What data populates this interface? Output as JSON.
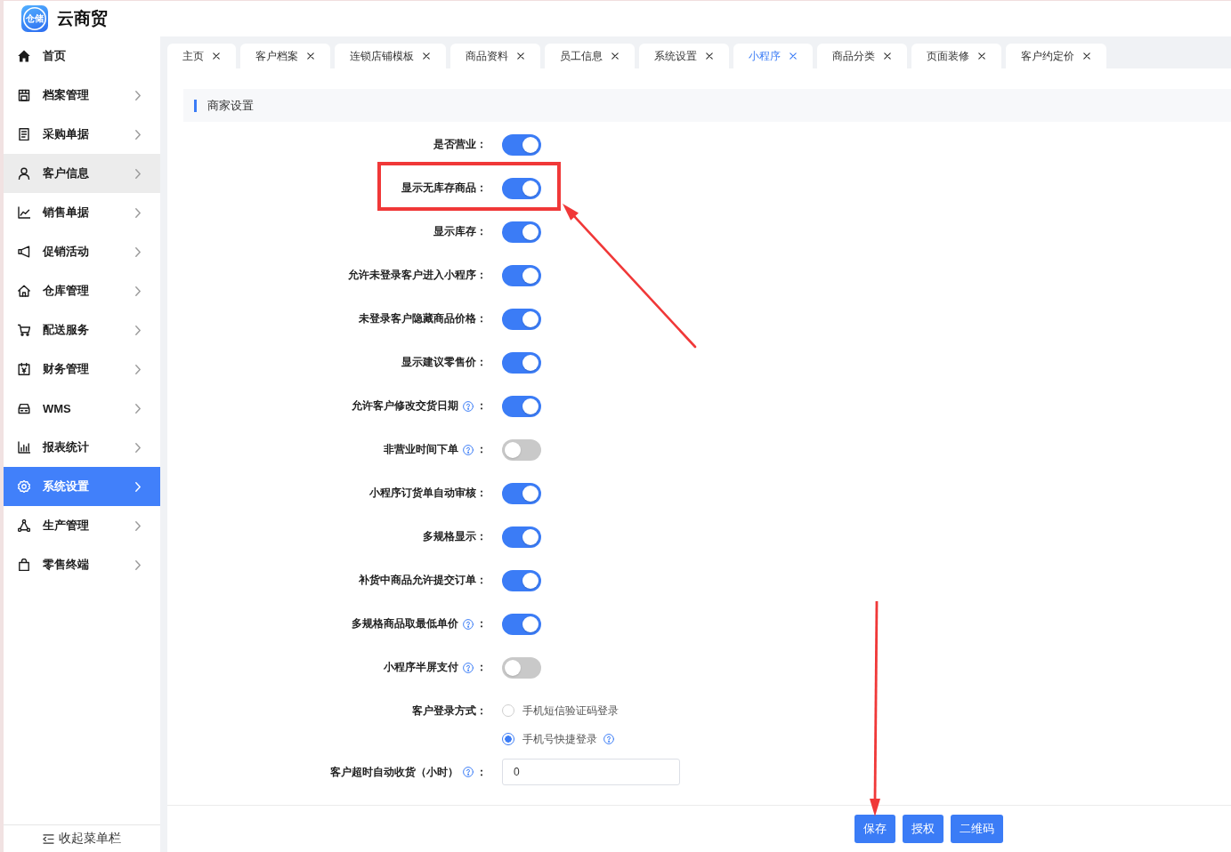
{
  "header": {
    "logo_text": "仓储",
    "title": "云商贸"
  },
  "sidebar": {
    "items": [
      {
        "label": "首页",
        "expandable": false,
        "selected": false,
        "hovered": false
      },
      {
        "label": "档案管理",
        "expandable": true,
        "selected": false,
        "hovered": false
      },
      {
        "label": "采购单据",
        "expandable": true,
        "selected": false,
        "hovered": false
      },
      {
        "label": "客户信息",
        "expandable": true,
        "selected": false,
        "hovered": true
      },
      {
        "label": "销售单据",
        "expandable": true,
        "selected": false,
        "hovered": false
      },
      {
        "label": "促销活动",
        "expandable": true,
        "selected": false,
        "hovered": false
      },
      {
        "label": "仓库管理",
        "expandable": true,
        "selected": false,
        "hovered": false
      },
      {
        "label": "配送服务",
        "expandable": true,
        "selected": false,
        "hovered": false
      },
      {
        "label": "财务管理",
        "expandable": true,
        "selected": false,
        "hovered": false
      },
      {
        "label": "WMS",
        "expandable": true,
        "selected": false,
        "hovered": false
      },
      {
        "label": "报表统计",
        "expandable": true,
        "selected": false,
        "hovered": false
      },
      {
        "label": "系统设置",
        "expandable": true,
        "selected": true,
        "hovered": false
      },
      {
        "label": "生产管理",
        "expandable": true,
        "selected": false,
        "hovered": false
      },
      {
        "label": "零售终端",
        "expandable": true,
        "selected": false,
        "hovered": false
      }
    ],
    "collapse_label": "收起菜单栏"
  },
  "tabs": [
    {
      "label": "主页",
      "selected": false
    },
    {
      "label": "客户档案",
      "selected": false
    },
    {
      "label": "连锁店铺模板",
      "selected": false
    },
    {
      "label": "商品资料",
      "selected": false
    },
    {
      "label": "员工信息",
      "selected": false
    },
    {
      "label": "系统设置",
      "selected": false
    },
    {
      "label": "小程序",
      "selected": true
    },
    {
      "label": "商品分类",
      "selected": false
    },
    {
      "label": "页面装修",
      "selected": false
    },
    {
      "label": "客户约定价",
      "selected": false
    }
  ],
  "section_title": "商家设置",
  "settings": [
    {
      "kind": "switch",
      "label": "是否营业：",
      "help": false,
      "on": true,
      "annotated": false
    },
    {
      "kind": "switch",
      "label": "显示无库存商品：",
      "help": false,
      "on": true,
      "annotated": true
    },
    {
      "kind": "switch",
      "label": "显示库存：",
      "help": false,
      "on": true,
      "annotated": false
    },
    {
      "kind": "switch",
      "label": "允许未登录客户进入小程序：",
      "help": false,
      "on": true,
      "annotated": false
    },
    {
      "kind": "switch",
      "label": "未登录客户隐藏商品价格：",
      "help": false,
      "on": true,
      "annotated": false
    },
    {
      "kind": "switch",
      "label": "显示建议零售价：",
      "help": false,
      "on": true,
      "annotated": false
    },
    {
      "kind": "switch",
      "label": "允许客户修改交货日期",
      "help": true,
      "suffix": "：",
      "on": true,
      "annotated": false
    },
    {
      "kind": "switch",
      "label": "非营业时间下单",
      "help": true,
      "suffix": "：",
      "on": false,
      "annotated": false
    },
    {
      "kind": "switch",
      "label": "小程序订货单自动审核：",
      "help": false,
      "on": true,
      "annotated": false
    },
    {
      "kind": "switch",
      "label": "多规格显示：",
      "help": false,
      "on": true,
      "annotated": false
    },
    {
      "kind": "switch",
      "label": "补货中商品允许提交订单：",
      "help": false,
      "on": true,
      "annotated": false
    },
    {
      "kind": "switch",
      "label": "多规格商品取最低单价",
      "help": true,
      "suffix": "：",
      "on": true,
      "annotated": false
    },
    {
      "kind": "switch",
      "label": "小程序半屏支付",
      "help": true,
      "suffix": "：",
      "on": false,
      "annotated": false
    },
    {
      "kind": "radio",
      "label": "客户登录方式：",
      "help": false,
      "annotated": false,
      "options": [
        {
          "label": "手机短信验证码登录",
          "selected": false,
          "help": false
        },
        {
          "label": "手机号快捷登录",
          "selected": true,
          "help": true
        }
      ]
    },
    {
      "kind": "number",
      "label": "客户超时自动收货（小时）",
      "help": true,
      "suffix": "：",
      "value": "0",
      "annotated": false
    }
  ],
  "footer_buttons": [
    {
      "label": "保存",
      "annotated": true
    },
    {
      "label": "授权",
      "annotated": false
    },
    {
      "label": "二维码",
      "annotated": false
    }
  ]
}
